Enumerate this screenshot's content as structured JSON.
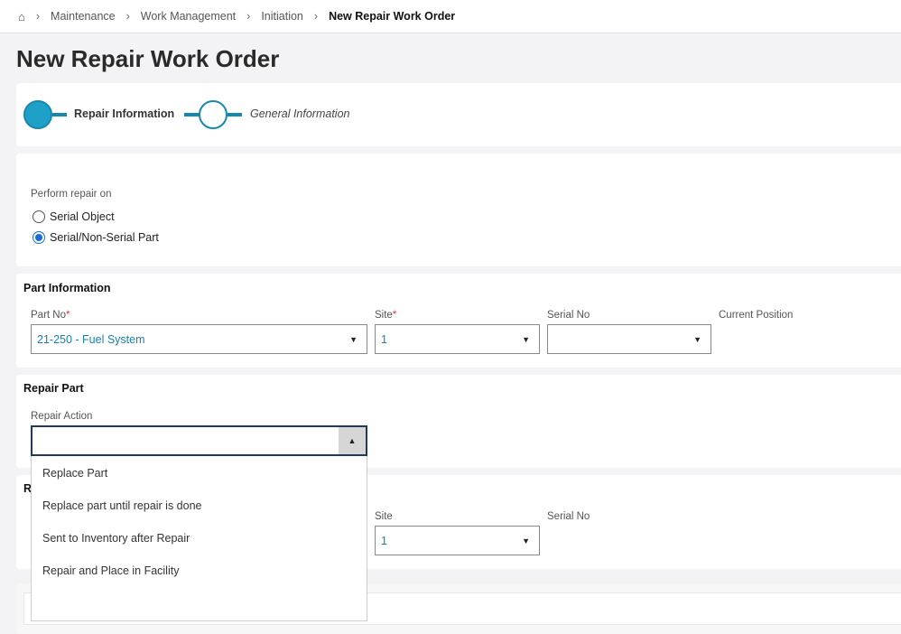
{
  "breadcrumb": [
    "Maintenance",
    "Work Management",
    "Initiation",
    "New Repair Work Order"
  ],
  "title": "New Repair Work Order",
  "steps": [
    "Repair Information",
    "General Information"
  ],
  "colors": {
    "accent": "#1fa0c9"
  },
  "perform": {
    "label": "Perform repair on",
    "options": [
      "Serial Object",
      "Serial/Non-Serial Part"
    ],
    "selected": "Serial/Non-Serial Part"
  },
  "part_info": {
    "heading": "Part Information",
    "part_no_label": "Part No",
    "part_no": "21-250 - Fuel System",
    "site_label": "Site",
    "site": "1",
    "serial_label": "Serial No",
    "serial": "",
    "position_label": "Current Position"
  },
  "repair_part": {
    "heading": "Repair Part",
    "action_label": "Repair Action",
    "action": "",
    "options": [
      "Replace Part",
      "Replace part until repair is done",
      "Sent to Inventory after Repair",
      "Repair and Place in Facility"
    ]
  },
  "replace": {
    "heading": "R",
    "site_label": "Site",
    "site": "1",
    "serial_label": "Serial No"
  },
  "req": "*"
}
